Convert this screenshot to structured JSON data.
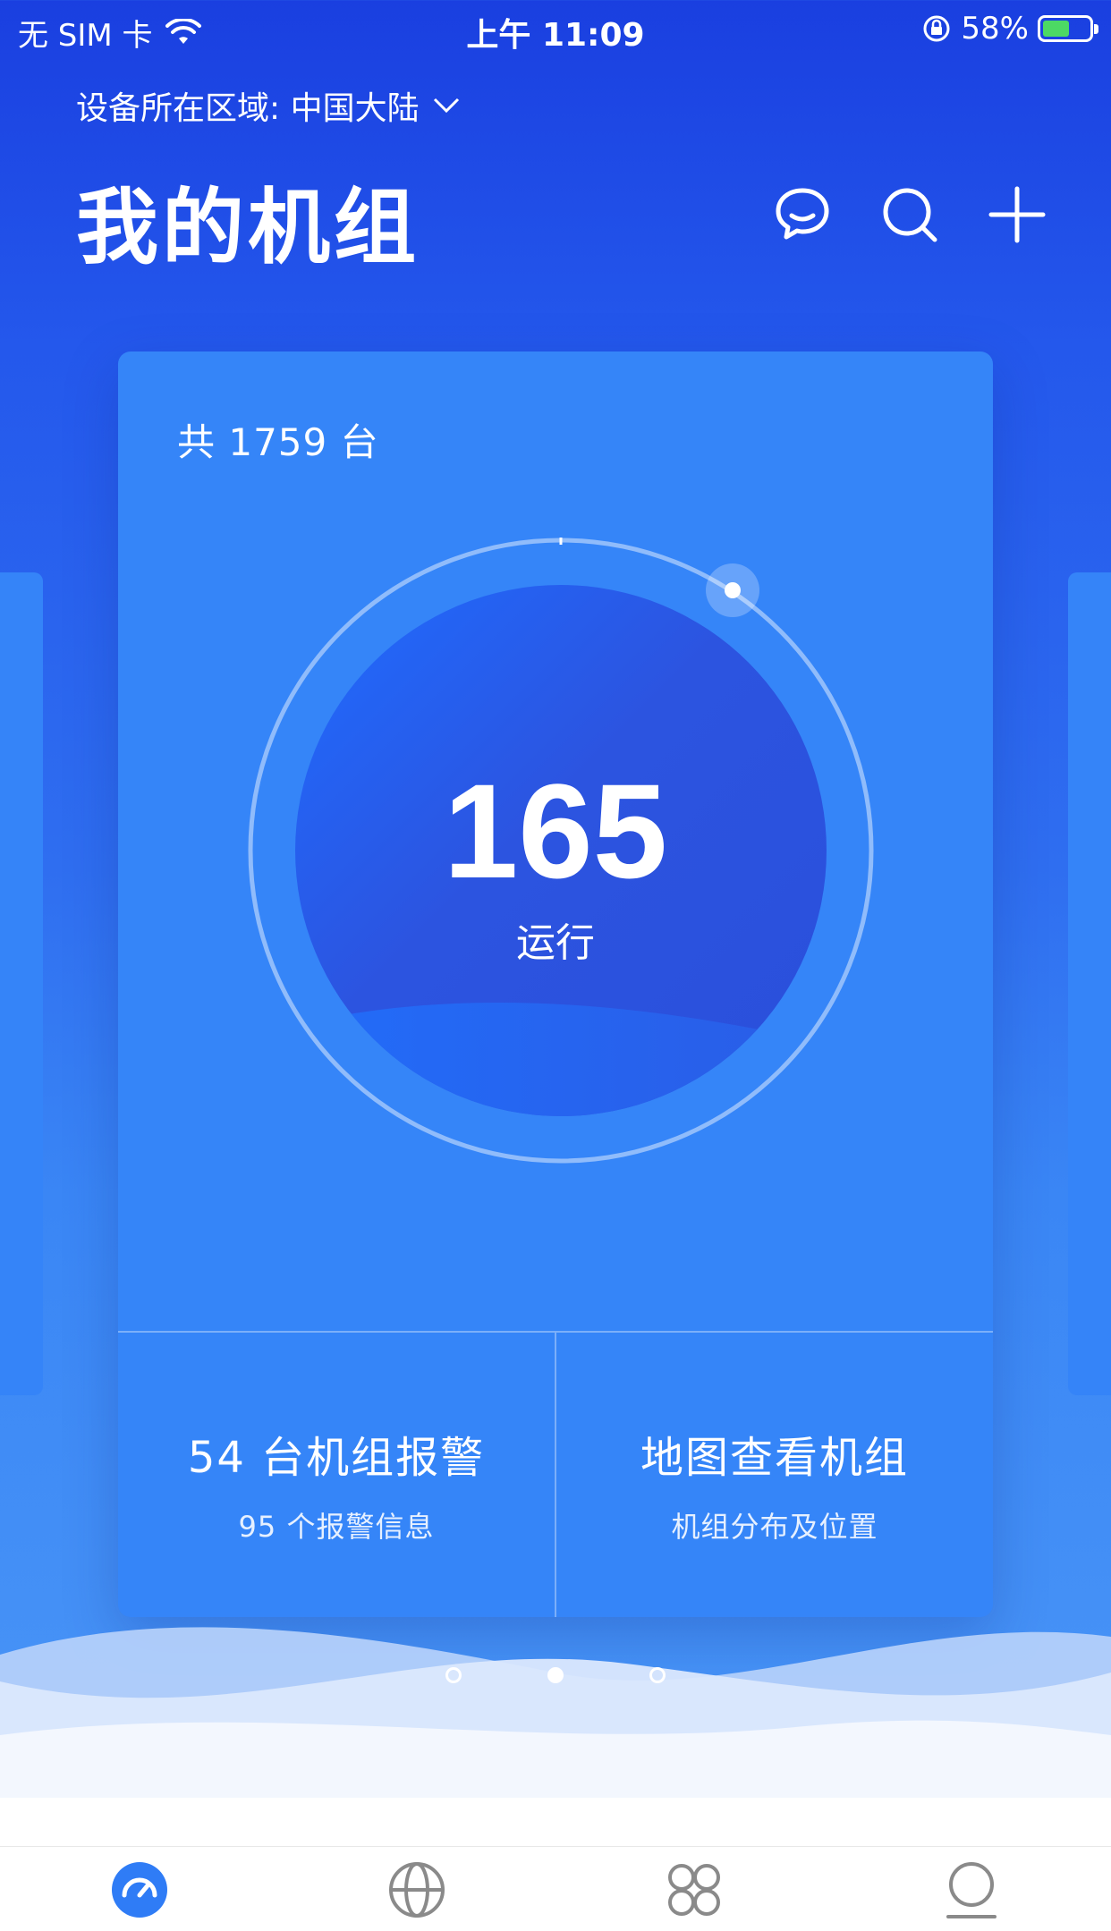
{
  "status_bar": {
    "carrier": "无 SIM 卡",
    "time": "上午 11:09",
    "battery_percent": "58%",
    "battery_level": 0.58,
    "battery_fill_color": "#4cd964"
  },
  "header": {
    "region_text": "设备所在区域: 中国大陆",
    "title": "我的机组",
    "icons": [
      "message-icon",
      "search-icon",
      "add-icon"
    ]
  },
  "card": {
    "total_text": "共 1759 台",
    "running_count": "165",
    "running_label": "运行",
    "alarm": {
      "title": "54 台机组报警",
      "subtitle": "95 个报警信息"
    },
    "map": {
      "title": "地图查看机组",
      "subtitle": "机组分布及位置"
    }
  },
  "pager": {
    "count": 3,
    "active_index": 1
  },
  "tabbar": {
    "tabs": [
      "dashboard-icon",
      "globe-icon",
      "apps-icon",
      "profile-icon"
    ],
    "active_index": 0,
    "active_color": "#2f7cf6",
    "inactive_color": "#8a8a8a"
  }
}
